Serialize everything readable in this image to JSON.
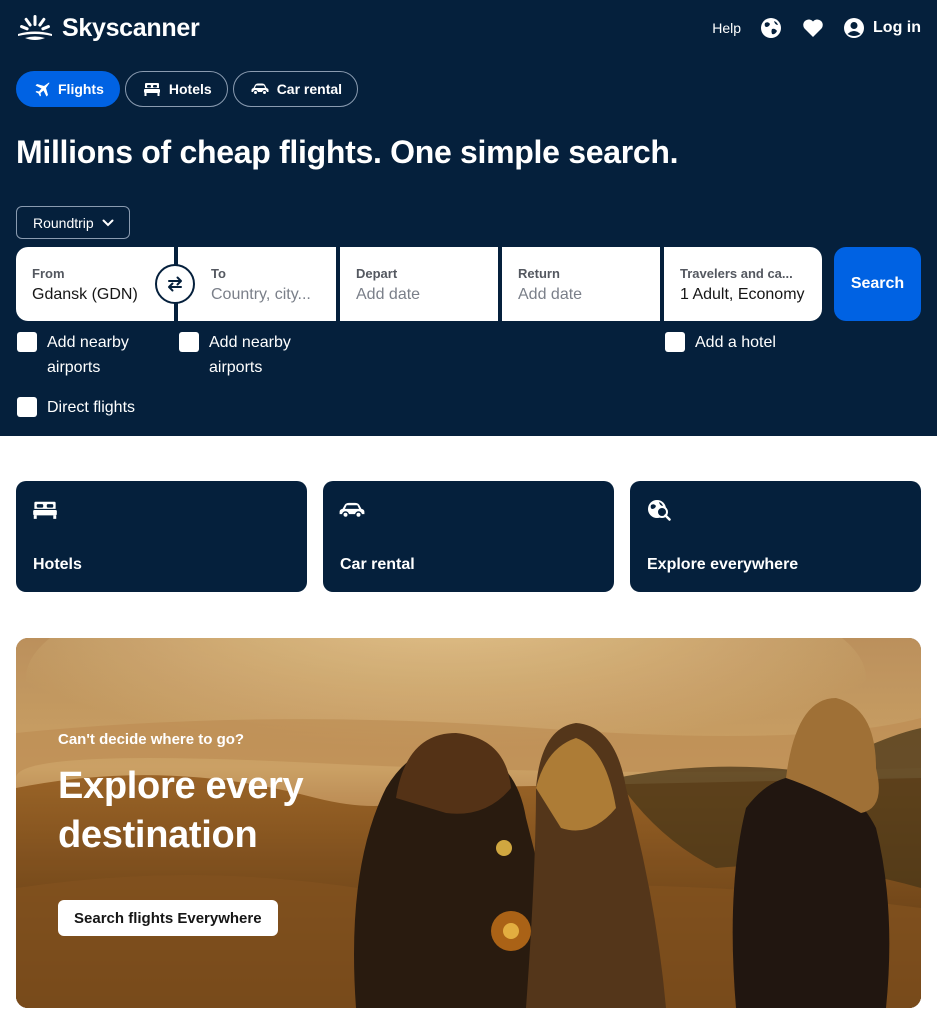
{
  "brand": {
    "name": "Skyscanner"
  },
  "topnav": {
    "help": "Help",
    "login": "Log in"
  },
  "tabs": [
    {
      "label": "Flights",
      "icon": "plane-icon",
      "active": true
    },
    {
      "label": "Hotels",
      "icon": "bed-icon",
      "active": false
    },
    {
      "label": "Car rental",
      "icon": "car-icon",
      "active": false
    }
  ],
  "headline": "Millions of cheap flights. One simple search.",
  "trip_type": "Roundtrip",
  "search": {
    "from": {
      "label": "From",
      "value": "Gdansk (GDN)"
    },
    "to": {
      "label": "To",
      "placeholder": "Country, city..."
    },
    "depart": {
      "label": "Depart",
      "placeholder": "Add date"
    },
    "return": {
      "label": "Return",
      "placeholder": "Add date"
    },
    "travelers": {
      "label": "Travelers and ca...",
      "value": "1 Adult, Economy"
    },
    "button": "Search"
  },
  "options": {
    "nearby_from": [
      "Add nearby",
      "airports"
    ],
    "nearby_to": [
      "Add nearby",
      "airports"
    ],
    "direct": "Direct flights",
    "hotel": "Add a hotel"
  },
  "cards": [
    {
      "label": "Hotels",
      "icon": "bed-icon"
    },
    {
      "label": "Car rental",
      "icon": "car-icon"
    },
    {
      "label": "Explore everywhere",
      "icon": "globe-search-icon"
    }
  ],
  "hero": {
    "kicker": "Can't decide where to go?",
    "title": "Explore every destination",
    "cta": "Search flights Everywhere"
  },
  "colors": {
    "navy": "#05203c",
    "blue": "#0062e3",
    "white": "#ffffff"
  }
}
